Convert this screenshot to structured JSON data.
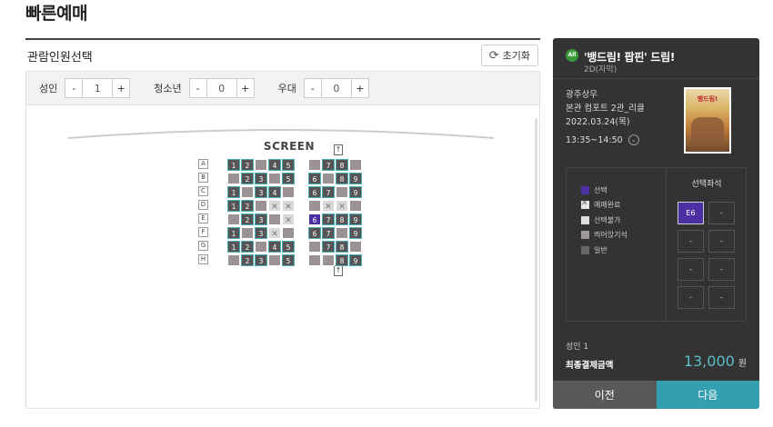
{
  "page": {
    "title": "빠른예매"
  },
  "left": {
    "header": "관람인원선택",
    "reset_label": "초기화",
    "counters": [
      {
        "label": "성인",
        "minus": "-",
        "value": "1",
        "plus": "+"
      },
      {
        "label": "청소년",
        "minus": "-",
        "value": "0",
        "plus": "+"
      },
      {
        "label": "우대",
        "minus": "-",
        "value": "0",
        "plus": "+"
      }
    ],
    "screen_label": "SCREEN",
    "exit_glyph": "↑",
    "row_labels": [
      "A",
      "B",
      "C",
      "D",
      "E",
      "F",
      "G",
      "H"
    ]
  },
  "right": {
    "age_badge": "All",
    "movie_title": "'뱅드림! 팝핀' 드림!",
    "movie_format": "2D(자막)",
    "cinema": "광주상무",
    "screen": "본관 컴포트 2관_리클",
    "date": "2022.03.24(목)",
    "time": "13:35~14:50",
    "time_chevron": "⌄",
    "poster_title": "뱅드림!",
    "legend": [
      {
        "key": "sel",
        "label": "선택"
      },
      {
        "key": "done",
        "label": "예매완료"
      },
      {
        "key": "na",
        "label": "선택불가"
      },
      {
        "key": "dist",
        "label": "띄어앉기석"
      },
      {
        "key": "gen",
        "label": "일반"
      }
    ],
    "selected_title": "선택좌석",
    "selected_slots": [
      "E6",
      "-",
      "-",
      "-",
      "-",
      "-",
      "-",
      "-"
    ],
    "count_text": "성인 1",
    "total_label": "최종결제금액",
    "total_amount": "13,000",
    "currency": "원",
    "prev_label": "이전",
    "next_label": "다음"
  },
  "colors": {
    "accent": "#339fb0",
    "selected": "#4b2fa3",
    "available_border": "#4ab0b8",
    "distance_seat": "#9b9393",
    "panel_bg": "#333333"
  }
}
